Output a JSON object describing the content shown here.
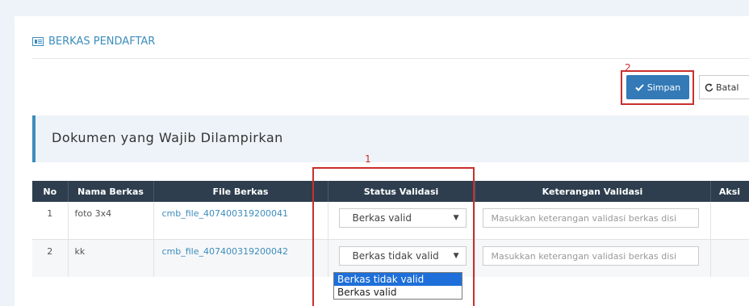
{
  "section": {
    "title": "BERKAS PENDAFTAR",
    "icon": "list-alt-icon"
  },
  "toolbar": {
    "save_label": "Simpan",
    "save_icon": "checkmark-icon",
    "cancel_label": "Batal",
    "cancel_icon": "refresh-icon"
  },
  "annotations": {
    "marker1": "1",
    "marker2": "2",
    "color": "#c9302c"
  },
  "callout": {
    "heading": "Dokumen yang Wajib Dilampirkan"
  },
  "table": {
    "headers": [
      "No",
      "Nama Berkas",
      "File Berkas",
      "Status Validasi",
      "Keterangan Validasi",
      "Aksi"
    ],
    "rows": [
      {
        "no": "1",
        "name": "foto 3x4",
        "file": "cmb_file_407400319200041",
        "status": "Berkas valid",
        "note_placeholder": "Masukkan keterangan validasi berkas disi"
      },
      {
        "no": "2",
        "name": "kk",
        "file": "cmb_file_407400319200042",
        "status": "Berkas tidak valid",
        "note_placeholder": "Masukkan keterangan validasi berkas disi"
      }
    ]
  },
  "dropdown": {
    "options": [
      "Berkas tidak valid",
      "Berkas valid"
    ],
    "highlighted": "Berkas tidak valid"
  },
  "colors": {
    "accent": "#3c8dbc",
    "header_bg": "#2e3e4e",
    "primary_button": "#337ab7",
    "highlight": "#1e6fd9"
  }
}
